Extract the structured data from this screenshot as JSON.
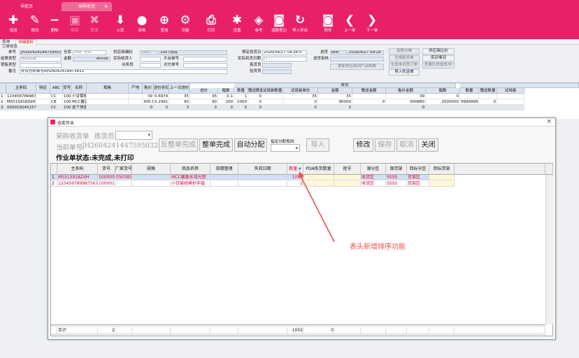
{
  "tabs": {
    "nav": "导航页",
    "purchase": "采购收货",
    "close": "×"
  },
  "toolbar": [
    {
      "icon": "plus-icon",
      "glyph": "✚",
      "label": "增加",
      "enabled": true
    },
    {
      "icon": "pencil-icon",
      "glyph": "✎",
      "label": "修改",
      "enabled": true
    },
    {
      "icon": "minus-icon",
      "glyph": "−",
      "label": "删除",
      "enabled": true
    },
    {
      "icon": "save-icon",
      "glyph": "▣",
      "label": "保存",
      "enabled": false
    },
    {
      "icon": "cancel-icon",
      "glyph": "✖",
      "label": "取消",
      "enabled": false
    },
    {
      "icon": "import-icon",
      "glyph": "⬇",
      "label": "入库",
      "enabled": true
    },
    {
      "icon": "user-icon",
      "glyph": "●",
      "label": "审核",
      "enabled": true
    },
    {
      "icon": "zoom-icon",
      "glyph": "⊕",
      "label": "查询",
      "enabled": true
    },
    {
      "icon": "gear-icon",
      "glyph": "⚙",
      "label": "功能",
      "enabled": true
    },
    {
      "icon": "printer-icon",
      "glyph": "⎙",
      "label": "打印",
      "enabled": true
    },
    {
      "icon": "wrench-icon",
      "glyph": "✱",
      "label": "设置",
      "enabled": true
    },
    {
      "icon": "layers-icon",
      "glyph": "◈",
      "label": "参考",
      "enabled": true
    },
    {
      "icon": "report-icon",
      "glyph": "◙",
      "label": "退款登记",
      "enabled": true
    },
    {
      "icon": "refresh-icon",
      "glyph": "↻",
      "label": "导入导出",
      "enabled": true
    },
    {
      "icon": "search-doc-icon",
      "glyph": "◙",
      "label": "附件",
      "enabled": true
    },
    {
      "icon": "prev-icon",
      "glyph": "❮",
      "label": "上一单",
      "enabled": true
    },
    {
      "icon": "next-icon",
      "glyph": "❯",
      "label": "下一单",
      "enabled": true
    }
  ],
  "subtabs": {
    "query": "查询",
    "detail": "详细资料"
  },
  "form": {
    "section": "订单信息",
    "order_no_label": "单号",
    "order_no": "JH26042414475950328",
    "warehouse_label": "仓库",
    "warehouse": "888, 仓库",
    "supplier_code_label": "供应商编码",
    "supplier_code": "1007",
    "supplier_name": "1007测试",
    "settle_label": "结算类型",
    "settle": "购销货款",
    "amount_label": "金额",
    "amount": "90036",
    "handler_label": "实际收货人",
    "platform_label": "平台单号",
    "sales_type_label": "销售类型",
    "biz_label": "业务员",
    "external_label": "对方单号",
    "remark_label": "备注",
    "remark": "补货分析单号RH26042414473431",
    "plan_date_label": "预定到货日",
    "plan_date": "2026/04/27 09:26:0",
    "actual_date_label": "实际到货日期",
    "actual_date": "  /  /    :  :",
    "picker_label": "拣货员",
    "checker_label": "验货员",
    "status_label": "进货",
    "status": "test",
    "status_date": "2026/4/27 09:26",
    "review_label": "进货审核",
    "btn_purchase_fee": "采购分摊",
    "btn_supplier_compare": "供应商比价",
    "btn_generate_plan": "生成配货单",
    "btn_stock_check": "库存情况",
    "btn_change_supplier": "更新供应商到产品档案",
    "btn_generate_unfinished": "生成未到货订单",
    "btn_view_history": "查看历史成本/价",
    "btn_import_task": "导入托运单"
  },
  "grid1": {
    "group_header": "收货",
    "headers": [
      "主条码",
      "特征",
      "ABC",
      "货号",
      "名称",
      "规格",
      "产地",
      "售价",
      "进价折扣",
      "上一次进价",
      "进价",
      "箱数",
      "数量",
      "赠送数量",
      "试用装数量",
      "试用装单价",
      "金额",
      "赠送金额",
      "售价金额",
      "箱数",
      "数量",
      "赠送数量",
      "试用装"
    ],
    "rows": [
      {
        "no": "1",
        "cells": [
          "12345678998756?",
          "",
          "CC",
          "1000016",
          "小甘菊精典护手霜（软管）75ml",
          "",
          "",
          "39",
          "0.6974",
          "35",
          "35",
          "0.1",
          "1",
          "0",
          "",
          "35",
          "35",
          "",
          "39",
          "0",
          "",
          "",
          ""
        ]
      },
      {
        "no": "2",
        "cells": [
          "M5515918ZdH",
          "",
          "CB",
          "1000005",
          "MCC馨香水润光感霜防晒乳霜Nroshi’*4",
          "",
          "",
          "300.88",
          "0.2991",
          "90",
          "90",
          "200",
          "1000",
          "0",
          "",
          "0",
          "90000",
          "0",
          "300880",
          "2000000",
          "9999999",
          "0",
          ""
        ]
      },
      {
        "no": "3",
        "cells": [
          "000019245157",
          "",
          "CC",
          "1000011",
          "这个快速发掘的时代我们两天都需要到",
          "",
          "",
          "0",
          "0",
          "3",
          "3",
          "0",
          "0",
          "0",
          "",
          "0",
          "0",
          "",
          "0",
          "",
          "",
          "",
          ""
        ]
      }
    ]
  },
  "dialog": {
    "title": "仓库作业",
    "type_label": "采购收货单",
    "picker_label": "拣货员:",
    "current_no_label": "当前单号:",
    "current_no": "JH26042414475950328",
    "status": "作业单状态:未完成,未打印",
    "btn_reverse": "反整单完成",
    "btn_complete": "整单完成",
    "btn_auto": "自动分配",
    "rule_label": "指定分配规则:",
    "btn_import": "导入",
    "btn_edit": "修改",
    "btn_save": "保存",
    "btn_cancel": "取消",
    "btn_close": "关闭",
    "headers": [
      "主条码",
      "货号",
      "厂家货号",
      "规格",
      "商品名称",
      "效期管理",
      "失效日期",
      "数量",
      "PDA拣货数量",
      "批号",
      "源分区",
      "源货架",
      "目标分区",
      "目标货架"
    ],
    "rows": [
      {
        "no": "1",
        "cells": [
          "M5515918ZdH",
          "1000005",
          "05038141",
          "",
          "MCC馨香水润光感",
          "",
          "",
          "1000",
          "",
          "",
          "收货区",
          "SSSS",
          "货架区",
          ""
        ]
      },
      {
        "no": "2",
        "cells": [
          "123456789987567",
          "1000016",
          "",
          "",
          "小甘菊经典护手霜",
          "",
          "",
          "2",
          "",
          "",
          "收货区",
          "SSSS",
          "货架区",
          ""
        ]
      }
    ],
    "footer": {
      "label": "合计",
      "count": "2",
      "qty": "1002",
      "zero": "0"
    }
  },
  "annotation": "表头新增排序功能"
}
